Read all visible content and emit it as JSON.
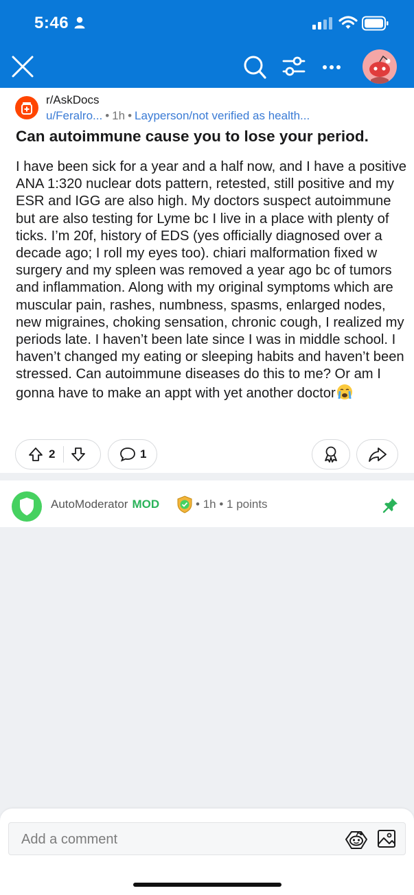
{
  "status_bar": {
    "time": "5:46"
  },
  "header": {
    "close_icon": "close-icon",
    "search_icon": "search-icon",
    "filter_icon": "sliders-icon",
    "more_icon": "more-horizontal-icon",
    "avatar_icon": "snoo-avatar-icon",
    "background_color": "#0a79d9"
  },
  "post": {
    "subreddit": "r/AskDocs",
    "author": "u/Feralro...",
    "age": "1h",
    "flair": "Layperson/not verified as health...",
    "title": "Can autoimmune cause you to lose your period.",
    "body": "I have been sick for a year and a half now, and I have a positive ANA 1:320 nuclear dots pattern, retested, still positive and my ESR and IGG are also high. My doctors suspect autoimmune but are also testing for Lyme bc I live in a place with plenty of ticks. I’m 20f, history of EDS (yes officially diagnosed over a decade ago; I roll my eyes too). chiari malformation fixed w surgery and my spleen was removed a year ago bc of tumors and inflammation. Along with my original symptoms which are muscular pain, rashes, numbness, spasms, enlarged nodes, new migraines, choking sensation, chronic cough, I realized my periods late. I haven’t been late since I was in middle school. I haven’t changed my eating or sleeping habits and haven’t been stressed. Can autoimmune diseases do this to me? Or am I gonna have to make an appt with yet another doctor",
    "upvotes": "2",
    "comments": "1",
    "subreddit_icon_color": "#ff4500"
  },
  "comment": {
    "author": "AutoModerator",
    "mod_label": "MOD",
    "age": "1h",
    "points": "1 points",
    "mod_color": "#2bb35a"
  },
  "composer": {
    "placeholder": "Add a comment"
  }
}
